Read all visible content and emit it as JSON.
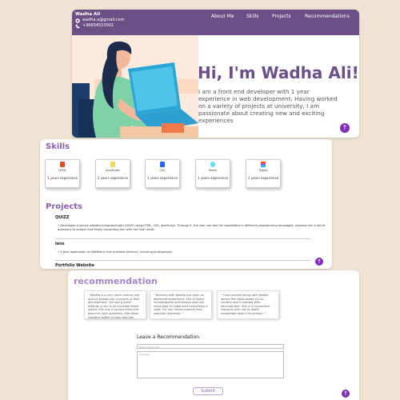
{
  "header": {
    "name": "Wadha Ali",
    "email": "wadha.a@gmail.com",
    "phone": "+96654533001",
    "nav": [
      "About Me",
      "Skills",
      "Projects",
      "Recommendations"
    ]
  },
  "hero": {
    "title": "Hi, I'm Wadha Ali!",
    "wave_emoji": "👋",
    "description": "I am a front end developer with 1 year experience in web development. Having worked on a variety of projects at university, I am passionate about creating new and exciting experiences"
  },
  "skills": {
    "title": "Skills",
    "items": [
      {
        "name": "HTML",
        "experience": "1 years experience",
        "color": "#e44d26"
      },
      {
        "name": "JavaScript",
        "experience": "1 years experience",
        "color": "#f0db4f"
      },
      {
        "name": "CSS",
        "experience": "1 years experience",
        "color": "#2965f1"
      },
      {
        "name": "React",
        "experience": "1 years experience",
        "color": "#61dafb"
      },
      {
        "name": "Figma",
        "experience": "1 years experience",
        "color": "#a259ff"
      }
    ]
  },
  "projects": {
    "title": "Projects",
    "items": [
      {
        "name": "QUIZZ",
        "description": "Developed a secure website integrated with QUIZZ using HTML, CSS, JavaScript. Through it, the user can test his capabilities in different programming languages, showing him a set of questions to answer and finally presenting him with the final result."
      },
      {
        "name": "lens",
        "description": "A Java application on NetBeans that provides services, including photography"
      },
      {
        "name": "Portfolio Website",
        "description": ""
      }
    ]
  },
  "recommendations": {
    "title": "recommendation",
    "items": [
      "\" Wadha is a very quick learner and quickly grasps key concepts of Web development. She got a great attitude & she is an excellent team player. She has a curious mind and asks the right questions. She takes initiative within a team and has potentials to lead the team. \"",
      "\" Working with Wadha has been an awesome experience. She is highly knowledgable and always goes the extra step to make sure everything is right. For any future projects then searcher expertise. \"",
      "\" I had worked along with Wadha during the initial phase of our venture which needed Web development. She is a committed resource who has in-depth knowledge about the domain. \""
    ],
    "form": {
      "title": "Leave a Recommendation",
      "name_placeholder": "Name (Optional)",
      "message_placeholder": "Message",
      "submit_label": "Submit"
    }
  },
  "up_arrow": "↑",
  "colors": {
    "accent": "#6b4f86",
    "button": "#7e2fb6",
    "title": "#8b5fb0"
  }
}
